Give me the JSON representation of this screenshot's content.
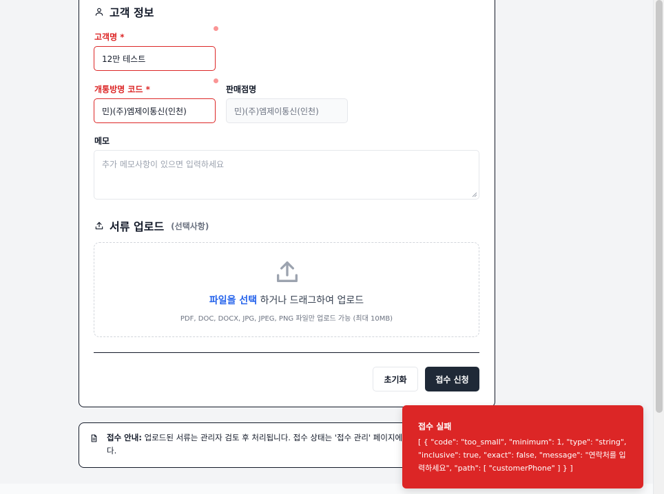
{
  "customer_section": {
    "title": "고객 정보",
    "name_label": "고객명 *",
    "name_value": "12만 테스트",
    "code_label": "개통방명 코드 *",
    "code_value": "민)(주)엠제이통신(인천)",
    "store_label": "판매점명",
    "store_value": "민)(주)엠제이통신(인천)",
    "memo_label": "메모",
    "memo_placeholder": "추가 메모사항이 있으면 입력하세요"
  },
  "upload_section": {
    "title": "서류 업로드",
    "optional": "(선택사항)",
    "select_link": "파일을 선택",
    "drop_text": " 하거나 드래그하여 업로드",
    "hint": "PDF, DOC, DOCX, JPG, JPEG, PNG 파일만 업로드 가능 (최대 10MB)"
  },
  "actions": {
    "reset_label": "초기화",
    "submit_label": "접수 신청"
  },
  "notice": {
    "title": "접수 안내:",
    "text": " 업로드된 서류는 관리자 검토 후 처리됩니다. 접수 상태는 '접수 관리' 페이지에서 확인하실 수 있습니다."
  },
  "toast": {
    "title": "접수 실패",
    "body": "[ { \"code\": \"too_small\", \"minimum\": 1, \"type\": \"string\", \"inclusive\": true, \"exact\": false, \"message\": \"연락처를 입력하세요\", \"path\": [ \"customerPhone\" ] } ]"
  },
  "colors": {
    "error": "#dc2626",
    "primary_button": "#1f2937",
    "link": "#2563eb"
  },
  "icons": {
    "customer": "user-icon",
    "upload": "upload-icon",
    "dropzone": "upload-cloud-icon",
    "notice": "document-icon"
  }
}
